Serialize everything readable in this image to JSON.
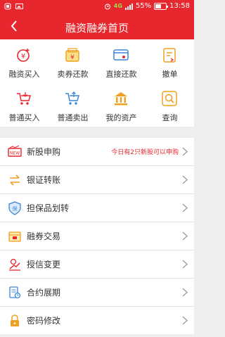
{
  "statusbar": {
    "network": "4G",
    "battery": "55%",
    "time": "13:58"
  },
  "header": {
    "title": "融资融券首页"
  },
  "grid": [
    {
      "label": "融资买入",
      "icon": "financing-buy-icon"
    },
    {
      "label": "卖券还款",
      "icon": "sell-repay-icon"
    },
    {
      "label": "直接还款",
      "icon": "direct-repay-icon"
    },
    {
      "label": "撤单",
      "icon": "cancel-order-icon"
    },
    {
      "label": "普通买入",
      "icon": "regular-buy-icon"
    },
    {
      "label": "普通卖出",
      "icon": "regular-sell-icon"
    },
    {
      "label": "我的资产",
      "icon": "assets-icon"
    },
    {
      "label": "查询",
      "icon": "query-icon"
    }
  ],
  "menu": [
    {
      "label": "新股申购",
      "note": "今日有2只新股可以申购",
      "icon": "new-stock-icon"
    },
    {
      "label": "银证转账",
      "icon": "transfer-icon"
    },
    {
      "label": "担保品划转",
      "icon": "collateral-icon"
    },
    {
      "label": "融券交易",
      "icon": "securities-lending-icon"
    },
    {
      "label": "授信变更",
      "icon": "credit-change-icon"
    },
    {
      "label": "合约展期",
      "icon": "contract-extension-icon"
    },
    {
      "label": "密码修改",
      "icon": "lock-icon"
    }
  ],
  "colors": {
    "brand": "#e8262d",
    "icon_orange": "#f0a020",
    "icon_blue": "#3a86d6"
  }
}
